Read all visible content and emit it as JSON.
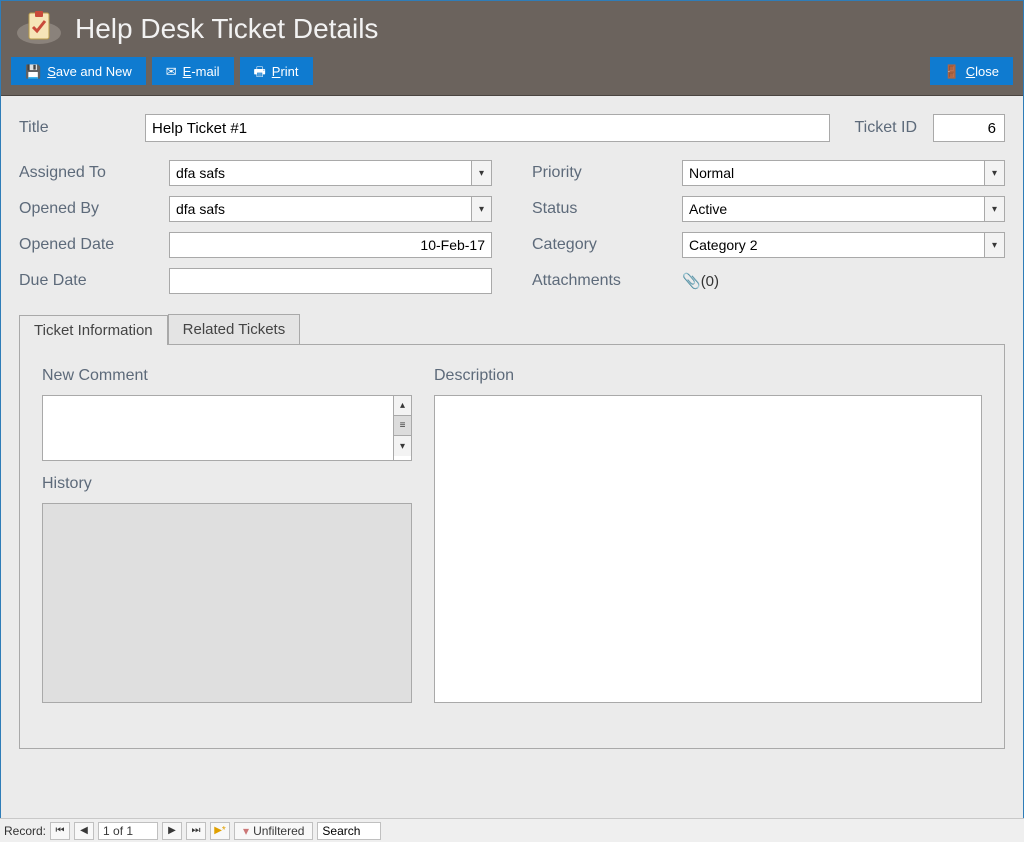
{
  "header": {
    "title": "Help Desk Ticket Details",
    "buttons": {
      "save_and_new": "Save and New",
      "email": "E-mail",
      "print": "Print",
      "close": "Close"
    }
  },
  "form": {
    "title_label": "Title",
    "title_value": "Help Ticket #1",
    "ticket_id_label": "Ticket ID",
    "ticket_id_value": "6",
    "left": {
      "assigned_to_label": "Assigned To",
      "assigned_to_value": "dfa safs",
      "opened_by_label": "Opened By",
      "opened_by_value": "dfa safs",
      "opened_date_label": "Opened Date",
      "opened_date_value": "10-Feb-17",
      "due_date_label": "Due Date",
      "due_date_value": ""
    },
    "right": {
      "priority_label": "Priority",
      "priority_value": "Normal",
      "status_label": "Status",
      "status_value": "Active",
      "category_label": "Category",
      "category_value": "Category 2",
      "attachments_label": "Attachments",
      "attachments_value": "(0)"
    }
  },
  "tabs": {
    "ticket_info": "Ticket Information",
    "related": "Related Tickets",
    "panel": {
      "new_comment_label": "New Comment",
      "history_label": "History",
      "description_label": "Description"
    }
  },
  "footer": {
    "record_label": "Record:",
    "position": "1 of 1",
    "filter_label": "Unfiltered",
    "search_placeholder": "Search"
  }
}
